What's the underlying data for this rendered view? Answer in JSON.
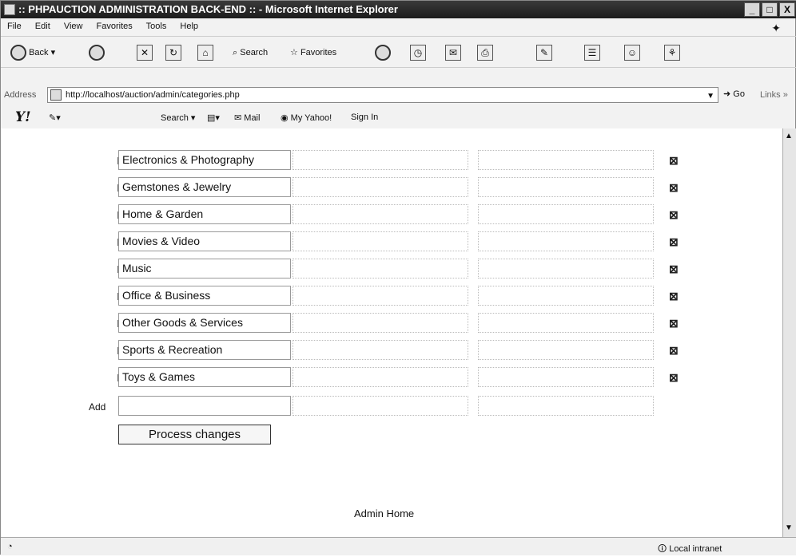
{
  "window": {
    "title": ":: PHPAUCTION ADMINISTRATION BACK-END :: - Microsoft Internet Explorer",
    "min": "_",
    "max": "□",
    "close": "X"
  },
  "menu": [
    "File",
    "Edit",
    "View",
    "Favorites",
    "Tools",
    "Help"
  ],
  "toolbar": {
    "back": "Back",
    "search": "Search",
    "favorites": "Favorites"
  },
  "address": {
    "label": "Address",
    "url": "http://localhost/auction/admin/categories.php",
    "go": "Go",
    "links": "Links"
  },
  "yahoo": {
    "search": "Search",
    "mail": "Mail",
    "myyahoo": "My Yahoo!",
    "signin": "Sign In"
  },
  "categories": [
    "Electronics & Photography",
    "Gemstones & Jewelry",
    "Home & Garden",
    "Movies & Video",
    "Music",
    "Office & Business",
    "Other Goods & Services",
    "Sports & Recreation",
    "Toys & Games"
  ],
  "form": {
    "add_label": "Add",
    "process_button": "Process changes",
    "admin_home": "Admin Home"
  },
  "status": {
    "zone": "Local intranet"
  }
}
